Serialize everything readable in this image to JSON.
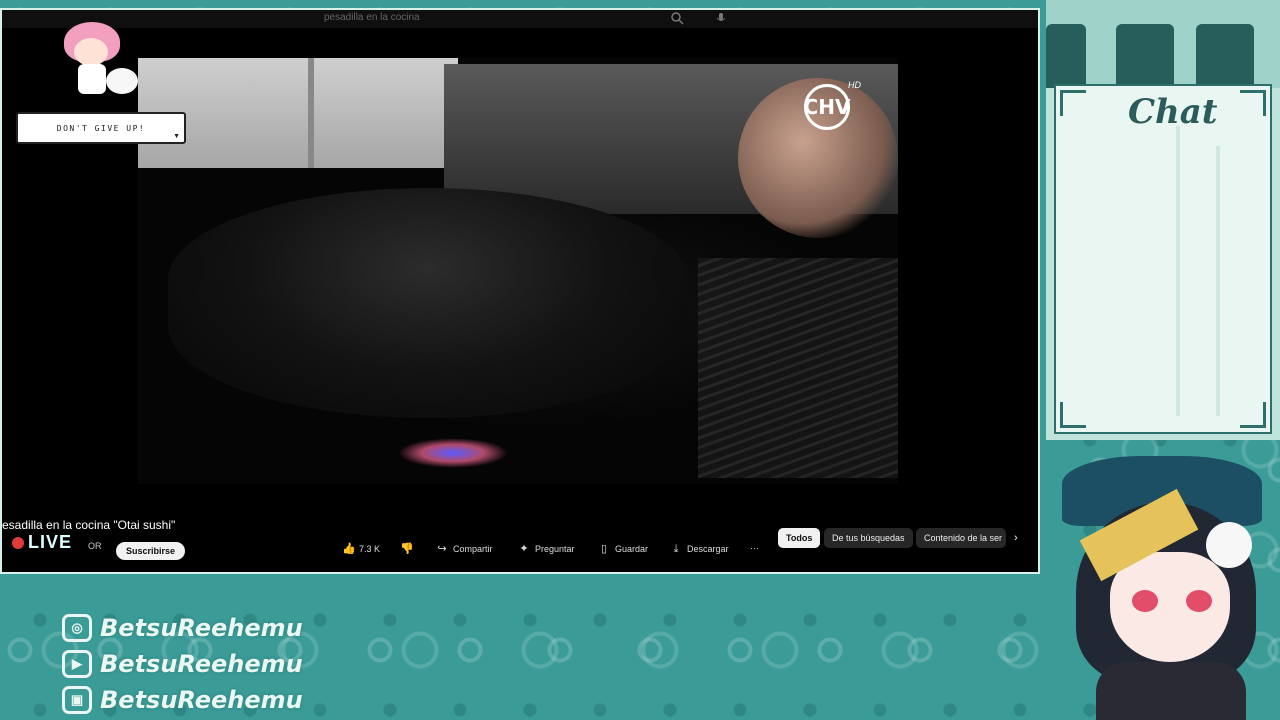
{
  "browser": {
    "search_query": "pesadilla en la cocina"
  },
  "video": {
    "channel_logo": "CHV",
    "channel_logo_sub": "HD",
    "title": "esadilla en la cocina \"Otai sushi\"",
    "channel_name_fragment": "OR",
    "subscribe_label": "Suscribirse",
    "likes": "7.3 K",
    "share_label": "Compartir",
    "ask_label": "Preguntar",
    "save_label": "Guardar",
    "download_label": "Descargar",
    "more_label": "···"
  },
  "chips": {
    "items": [
      {
        "label": "Todos",
        "active": true
      },
      {
        "label": "De tus búsquedas",
        "active": false
      },
      {
        "label": "Contenido de la ser",
        "active": false
      }
    ]
  },
  "overlay": {
    "live_label": "LIVE",
    "dont_give_up": "DON'T GIVE UP!",
    "chat_title": "Chat",
    "socials": [
      {
        "icon": "instagram-icon",
        "handle": "BetsuReehemu"
      },
      {
        "icon": "youtube-icon",
        "handle": "BetsuReehemu"
      },
      {
        "icon": "twitch-icon",
        "handle": "BetsuReehemu"
      }
    ]
  },
  "colors": {
    "teal_bg": "#3a9b97",
    "chat_border": "#2d6f6a",
    "live_dot": "#e03a3a"
  }
}
